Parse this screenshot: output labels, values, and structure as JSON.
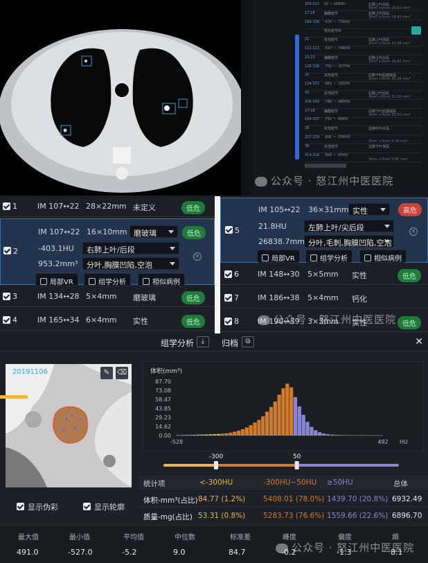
{
  "ct_sidebar": {
    "rows": [
      {
        "id": "209-213",
        "im": "52 ~ 166HU",
        "loc": "右肺上叶尖段",
        "size": "3mm",
        "vol": "9mm ×9mm 15.61 mm³"
      },
      {
        "id": "17-18",
        "im": "胸膜结节",
        "loc": "右肺上叶前段",
        "size": "4mm",
        "vol": "3mm ×3mm 18.43 mm³"
      },
      {
        "id": "104-108",
        "im": "-537 ~ -735HU",
        "loc": "",
        "size": "",
        "vol": ""
      },
      {
        "id": "",
        "im": "钙化结节中",
        "loc": "",
        "size": "",
        "vol": ""
      },
      {
        "id": "21",
        "im": "实性结节",
        "loc": "右肺上叶前段",
        "size": "",
        "vol": "3mm ×3mm 21.38 mm³"
      },
      {
        "id": "111-113",
        "im": "-537 ~ -796HU",
        "loc": "",
        "size": "",
        "vol": ""
      },
      {
        "id": "22-23",
        "im": "胸膜结节",
        "loc": "右肺上叶尖段",
        "size": "",
        "vol": "3mm ×3mm 26.81 mm³"
      },
      {
        "id": "126-128",
        "im": "-752 ~ -307HU",
        "loc": "",
        "size": "",
        "vol": ""
      },
      {
        "id": "21",
        "im": "实性结节",
        "loc": "右肺下叶后基底段",
        "size": "",
        "vol": "3mm ×3mm 30.26 mm³"
      },
      {
        "id": "124-152",
        "im": "-661 ~ -181HU",
        "loc": "",
        "size": "",
        "vol": ""
      },
      {
        "id": "35",
        "im": "实性结节",
        "loc": "右肺上叶后段",
        "size": "",
        "vol": "3mm ×3mm 31.02 mm³"
      },
      {
        "id": "206-209",
        "im": "-786 ~ -485HU",
        "loc": "",
        "size": "",
        "vol": ""
      },
      {
        "id": "17-18",
        "im": "胸膜结节",
        "loc": "右肺下叶后基底段",
        "size": "",
        "vol": "3mm ×3mm 33.53 mm³"
      },
      {
        "id": "104-107",
        "im": "-792 ~ -40HU",
        "loc": "",
        "size": "",
        "vol": ""
      },
      {
        "id": "26",
        "im": "实性结节",
        "loc": "右肺中叶外段",
        "size": "",
        "vol": ""
      },
      {
        "id": "227-229",
        "im": "-691 ~ -356HU",
        "loc": "",
        "size": "",
        "vol": "3mm ×3mm 6.34 mm³"
      },
      {
        "id": "38",
        "im": "实性结节",
        "loc": "左肺下叶背段",
        "size": "",
        "vol": ""
      },
      {
        "id": "314-316",
        "im": "-650 ~ -95HU",
        "loc": "",
        "size": "",
        "vol": "3mm ×3mm 5.65 mm³"
      }
    ]
  },
  "watermark": {
    "text": "公众号 · 怒江州中医医院"
  },
  "nodules_left": [
    {
      "num": "1",
      "im": "IM 107↔22",
      "size": "28×22mm",
      "type": "未定义",
      "badge": "低危"
    },
    {
      "num": "2",
      "im": "IM 107↔22",
      "size": "16×10mm",
      "type": "磨玻璃",
      "badge": "低危",
      "hu": "-403.1HU",
      "loc": "右肺上叶/后段",
      "vol": "953.2mm³",
      "sign": "分叶,胸膜凹陷,空泡",
      "actions": [
        "局部VR",
        "组学分析",
        "相似病例"
      ]
    },
    {
      "num": "3",
      "im": "IM 134↔28",
      "size": "5×4mm",
      "type": "磨玻璃",
      "badge": "低危"
    },
    {
      "num": "4",
      "im": "IM 165↔34",
      "size": "6×4mm",
      "type": "实性",
      "badge": "低危"
    }
  ],
  "nodules_right": [
    {
      "num": "5",
      "im": "IM 105↔22",
      "size": "36×31mm",
      "type": "实性",
      "badge": "高危",
      "hu": "21.8HU",
      "loc": "左肺上叶/尖后段",
      "vol": "26838.7mm³",
      "sign": "分叶,毛刺,胸膜凹陷,空泡",
      "actions": [
        "局部VR",
        "组学分析",
        "相似病例"
      ]
    },
    {
      "num": "6",
      "im": "IM 148↔30",
      "size": "5×5mm",
      "type": "实性",
      "badge": "低危"
    },
    {
      "num": "7",
      "im": "IM 186↔38",
      "size": "5×4mm",
      "type": "钙化",
      "badge": ""
    },
    {
      "num": "8",
      "im": "IM 190↔39",
      "size": "3×3mm",
      "type": "实性",
      "badge": "低危"
    }
  ],
  "analysis": {
    "title": "组学分析",
    "archive": "归档",
    "date": "20191106",
    "opt_pseudo": "显示伪彩",
    "opt_contour": "显示轮廓",
    "histogram_title": "体积(mm³)",
    "histogram_unit": "HU",
    "thresholds": [
      "-300",
      "50"
    ],
    "table_headers": [
      "统计项",
      "<-300HU",
      "-300HU~50HU",
      "≥50HU",
      "总体"
    ],
    "table_rows": [
      {
        "label": "体积-mm³(占比)",
        "c1": "84.77 (1.2%)",
        "c2": "5408.01 (78.0%)",
        "c3": "1439.70 (20.8%)",
        "total": "6932.49"
      },
      {
        "label": "质量-mg(占比)",
        "c1": "53.31 (0.8%)",
        "c2": "5283.73 (76.6%)",
        "c3": "1559.66 (22.6%)",
        "total": "6896.70"
      }
    ],
    "stats_labels": [
      "最大值",
      "最小值",
      "平均值",
      "中位数",
      "标准差",
      "峰度",
      "偏度",
      "熵"
    ],
    "stats_values": [
      "491.0",
      "-527.0",
      "-5.2",
      "9.0",
      "84.7",
      "-0.2",
      "-1.3",
      "8.1"
    ]
  },
  "chart_data": {
    "type": "bar",
    "title": "体积(mm³)",
    "xlabel": "HU",
    "ylabel": "",
    "xlim": [
      -528,
      492
    ],
    "ylim": [
      0,
      87.7
    ],
    "y_ticks": [
      "87.70",
      "73.08",
      "58.47",
      "43.85",
      "29.23",
      "14.62",
      "0.00"
    ],
    "x_ticks": [
      "-528",
      "492"
    ],
    "series": [
      {
        "name": "<-300HU",
        "color": "#e7b84a"
      },
      {
        "name": "-300HU~50HU",
        "color": "#d07a2e"
      },
      {
        "name": "≥50HU",
        "color": "#8a86d4"
      }
    ],
    "bins_x": [
      -520,
      -500,
      -480,
      -460,
      -440,
      -420,
      -400,
      -380,
      -360,
      -340,
      -320,
      -300,
      -280,
      -260,
      -240,
      -220,
      -200,
      -180,
      -160,
      -140,
      -120,
      -100,
      -80,
      -60,
      -40,
      -20,
      0,
      20,
      40,
      60,
      80,
      100,
      120,
      140,
      160,
      180,
      200,
      220,
      240,
      260,
      280,
      300,
      320,
      340,
      360,
      380,
      400,
      420,
      440,
      460,
      480
    ],
    "bins_y": [
      0.5,
      0.6,
      0.8,
      0.9,
      1.0,
      1.2,
      1.4,
      1.6,
      1.8,
      2.0,
      2.3,
      2.8,
      3.5,
      4.6,
      6.0,
      7.8,
      10.2,
      13.0,
      16.5,
      20.8,
      25.2,
      31.0,
      38.5,
      46.2,
      55.0,
      66.0,
      76.5,
      84.0,
      78.0,
      62.0,
      47.0,
      33.5,
      22.0,
      13.8,
      8.4,
      5.2,
      3.2,
      2.1,
      1.4,
      1.0,
      0.8,
      0.6,
      0.5,
      0.4,
      0.4,
      0.3,
      0.3,
      0.2,
      0.2,
      0.2,
      0.2
    ]
  },
  "colors": {
    "accent": "#3f6ea8",
    "low_risk": "#1f7a3c",
    "high_risk": "#c8443a",
    "orange": "#d07a2e",
    "purple": "#8a86d4",
    "yellow": "#e7b84a"
  }
}
